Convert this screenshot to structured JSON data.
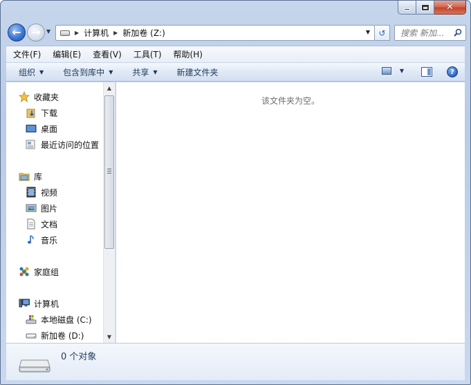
{
  "window": {
    "caption": {
      "minimize": "minimize",
      "maximize": "maximize",
      "close": "close"
    }
  },
  "address": {
    "crumbs": [
      "计算机",
      "新加卷 (Z:)"
    ],
    "search_placeholder": "搜索 新加..."
  },
  "menu": {
    "items": [
      "文件(F)",
      "编辑(E)",
      "查看(V)",
      "工具(T)",
      "帮助(H)"
    ]
  },
  "commands": {
    "organize": "组织",
    "include_in_library": "包含到库中",
    "share": "共享",
    "new_folder": "新建文件夹"
  },
  "nav": {
    "favorites": "收藏夹",
    "downloads": "下载",
    "desktop": "桌面",
    "recent": "最近访问的位置",
    "libraries": "库",
    "videos": "视频",
    "pictures": "图片",
    "documents": "文档",
    "music": "音乐",
    "homegroup": "家庭组",
    "computer": "计算机",
    "local_disk_c": "本地磁盘 (C:)",
    "new_volume_d": "新加卷 (D:)"
  },
  "content": {
    "empty_message": "该文件夹为空。"
  },
  "details": {
    "item_count": "0 个对象"
  },
  "colors": {
    "accent": "#3b78d6",
    "command_text": "#1e395b",
    "close_red": "#c2452c"
  }
}
